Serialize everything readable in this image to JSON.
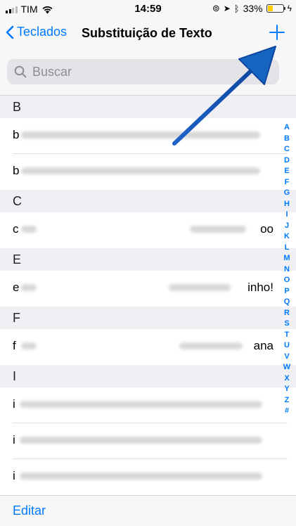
{
  "status_bar": {
    "carrier": "TIM",
    "time": "14:59",
    "battery_percent": "33%",
    "battery_level": 0.33,
    "battery_color": "#ffcc00"
  },
  "nav": {
    "back_label": "Teclados",
    "title": "Substituição de Texto",
    "add_icon": "plus-icon"
  },
  "search": {
    "placeholder": "Buscar"
  },
  "sections": [
    {
      "letter": "B",
      "rows": [
        {
          "shortcut": "b",
          "phrase": ""
        },
        {
          "shortcut": "b",
          "phrase": ""
        }
      ]
    },
    {
      "letter": "C",
      "rows": [
        {
          "shortcut": "c",
          "phrase": "oo"
        }
      ]
    },
    {
      "letter": "E",
      "rows": [
        {
          "shortcut": "e",
          "phrase": "inho!"
        }
      ]
    },
    {
      "letter": "F",
      "rows": [
        {
          "shortcut": "f",
          "phrase": "ana"
        }
      ]
    },
    {
      "letter": "I",
      "rows": [
        {
          "shortcut": "i",
          "phrase": ""
        },
        {
          "shortcut": "i",
          "phrase": ""
        },
        {
          "shortcut": "i",
          "phrase": ""
        }
      ]
    }
  ],
  "index_letters": [
    "A",
    "B",
    "C",
    "D",
    "E",
    "F",
    "G",
    "H",
    "I",
    "J",
    "K",
    "L",
    "M",
    "N",
    "O",
    "P",
    "Q",
    "R",
    "S",
    "T",
    "U",
    "V",
    "W",
    "X",
    "Y",
    "Z",
    "#"
  ],
  "toolbar": {
    "edit_label": "Editar"
  },
  "colors": {
    "accent": "#007aff",
    "annotation_arrow": "#1565c0"
  }
}
